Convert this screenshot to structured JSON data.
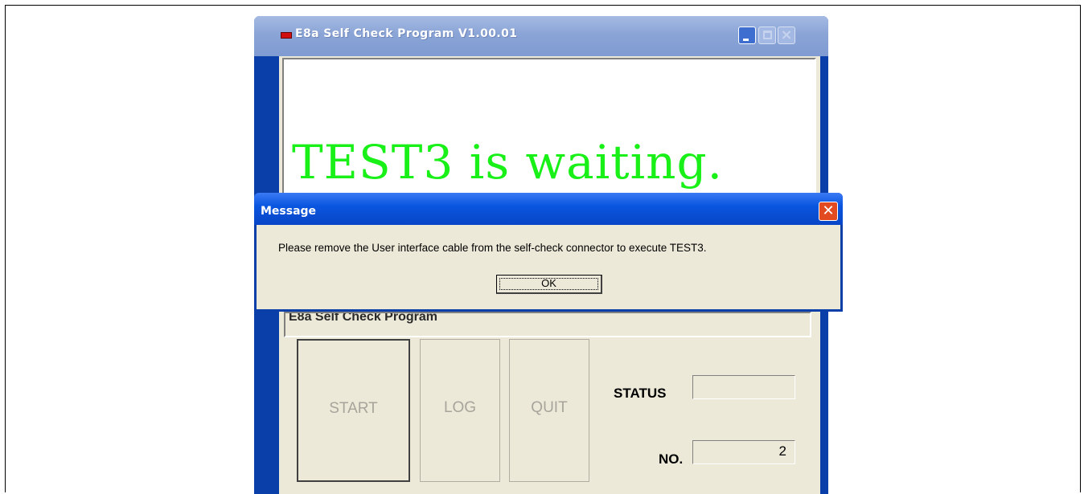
{
  "app": {
    "title": "E8a Self Check Program V1.00.01",
    "display_message": "TEST3 is waiting.",
    "program_label": "E8a Self Check Program",
    "buttons": {
      "start": "START",
      "log": "LOG",
      "quit": "QUIT"
    },
    "status_label": "STATUS",
    "status_value": "",
    "no_label": "NO.",
    "no_value": "2",
    "colors": {
      "message": "#18f018",
      "titlebar": "#8aa4d6"
    }
  },
  "dialog": {
    "title": "Message",
    "text": "Please remove the User interface cable from the self-check connector to execute TEST3.",
    "ok_label": "OK",
    "close_icon": "close-icon"
  }
}
